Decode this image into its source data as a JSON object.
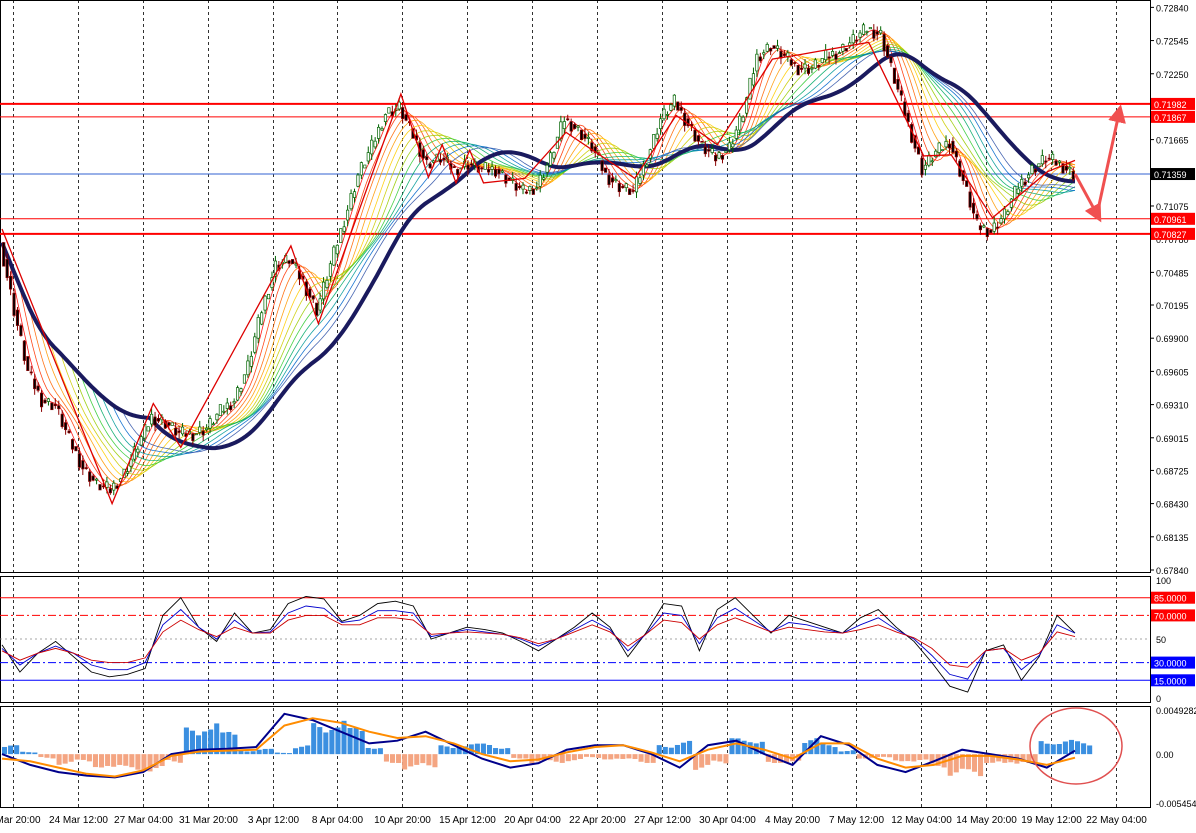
{
  "chart_data": [
    {
      "panel": "main",
      "type": "candlestick",
      "symbol": "",
      "x_tick_labels": [
        "Mar 20:00",
        "24 Mar 12:00",
        "27 Mar 04:00",
        "31 Mar 20:00",
        "3 Apr 12:00",
        "8 Apr 04:00",
        "10 Apr 20:00",
        "15 Apr 12:00",
        "20 Apr 04:00",
        "22 Apr 20:00",
        "27 Apr 12:00",
        "30 Apr 04:00",
        "4 May 20:00",
        "7 May 12:00",
        "12 May 04:00",
        "14 May 20:00",
        "19 May 12:00",
        "22 May 04:00"
      ],
      "y_tick_labels": [
        "0.72840",
        "0.72545",
        "0.72250",
        "0.71665",
        "0.71075",
        "0.70780",
        "0.70485",
        "0.70195",
        "0.69900",
        "0.69605",
        "0.69310",
        "0.69015",
        "0.68725",
        "0.68430",
        "0.68135",
        "0.67840"
      ],
      "ylim": [
        0.6784,
        0.7287
      ],
      "current_price": "0.71359",
      "price_close_path": [
        0.7075,
        0.7015,
        0.696,
        0.6935,
        0.693,
        0.69,
        0.6875,
        0.686,
        0.6855,
        0.687,
        0.6895,
        0.692,
        0.6915,
        0.6905,
        0.6905,
        0.691,
        0.6925,
        0.6935,
        0.6965,
        0.7015,
        0.7055,
        0.706,
        0.704,
        0.7015,
        0.7055,
        0.7095,
        0.7135,
        0.716,
        0.719,
        0.7195,
        0.717,
        0.7145,
        0.715,
        0.714,
        0.7145,
        0.714,
        0.714,
        0.713,
        0.712,
        0.7125,
        0.715,
        0.7185,
        0.7175,
        0.716,
        0.7135,
        0.7125,
        0.712,
        0.715,
        0.7185,
        0.72,
        0.718,
        0.716,
        0.715,
        0.716,
        0.719,
        0.724,
        0.725,
        0.724,
        0.723,
        0.723,
        0.724,
        0.7245,
        0.7255,
        0.7265,
        0.726,
        0.722,
        0.718,
        0.714,
        0.7155,
        0.7165,
        0.713,
        0.709,
        0.7085,
        0.71,
        0.7125,
        0.714,
        0.715,
        0.7145,
        0.7136
      ],
      "horizontal_levels": [
        {
          "label": "0.71982",
          "value": 0.71982,
          "color": "#ff0000"
        },
        {
          "label": "0.71867",
          "value": 0.71867,
          "color": "#ff0000"
        },
        {
          "label": "0.70961",
          "value": 0.70961,
          "color": "#ff0000"
        },
        {
          "label": "0.70827",
          "value": 0.70827,
          "color": "#ff0000"
        }
      ],
      "moving_average_ribbon": true,
      "thick_moving_average_color": "#1a1a5e",
      "zigzag_color": "#dd0000",
      "arrow_color": "#f05050"
    },
    {
      "panel": "oscillator",
      "type": "line",
      "y_tick_labels": [
        "100",
        "50",
        "0"
      ],
      "ylim": [
        0,
        100
      ],
      "levels": [
        {
          "label": "85.0000",
          "value": 85,
          "color": "#ff0000"
        },
        {
          "label": "70.0000",
          "value": 70,
          "color": "#ff0000"
        },
        {
          "label": "30.0000",
          "value": 30,
          "color": "#0000ff"
        },
        {
          "label": "15.0000",
          "value": 15,
          "color": "#0000ff"
        }
      ],
      "series": [
        {
          "color": "#000000",
          "values": [
            45,
            22,
            38,
            48,
            35,
            22,
            18,
            20,
            25,
            70,
            85,
            60,
            48,
            72,
            55,
            58,
            80,
            86,
            84,
            65,
            70,
            80,
            82,
            78,
            50,
            55,
            60,
            58,
            55,
            48,
            40,
            50,
            60,
            72,
            60,
            35,
            55,
            80,
            78,
            40,
            75,
            85,
            70,
            55,
            70,
            65,
            60,
            55,
            68,
            75,
            60,
            48,
            30,
            10,
            5,
            40,
            45,
            15,
            35,
            70,
            55
          ]
        },
        {
          "color": "#0000cc",
          "values": [
            42,
            28,
            38,
            44,
            38,
            28,
            24,
            24,
            30,
            62,
            75,
            60,
            50,
            66,
            55,
            56,
            72,
            78,
            76,
            64,
            66,
            74,
            74,
            72,
            52,
            55,
            58,
            56,
            54,
            50,
            44,
            50,
            58,
            66,
            58,
            40,
            54,
            72,
            70,
            46,
            68,
            76,
            66,
            56,
            64,
            62,
            58,
            55,
            62,
            68,
            58,
            50,
            36,
            20,
            16,
            40,
            42,
            24,
            36,
            62,
            55
          ]
        },
        {
          "color": "#cc0000",
          "values": [
            40,
            32,
            38,
            42,
            38,
            32,
            30,
            30,
            34,
            56,
            66,
            58,
            52,
            60,
            55,
            55,
            66,
            70,
            70,
            62,
            62,
            68,
            68,
            66,
            54,
            55,
            56,
            55,
            54,
            51,
            46,
            50,
            56,
            62,
            56,
            44,
            54,
            66,
            64,
            50,
            62,
            68,
            62,
            56,
            60,
            58,
            56,
            55,
            58,
            62,
            56,
            51,
            42,
            28,
            26,
            40,
            42,
            32,
            38,
            56,
            52
          ]
        }
      ]
    },
    {
      "panel": "histogram",
      "type": "bar",
      "y_tick_labels": [
        "0.0049282",
        "0.00",
        "-0.0054546"
      ],
      "ylim": [
        -0.0054546,
        0.0049282
      ],
      "bar_colors": {
        "positive": "#3b8fe0",
        "negative": "#f4a582"
      },
      "values": [
        0.001,
        0.0003,
        -0.0005,
        -0.0012,
        -0.001,
        -0.0015,
        -0.002,
        -0.0018,
        -0.0022,
        -0.001,
        0.003,
        0.0042,
        0.0025,
        0.0005,
        0.0006,
        0.0002,
        0.001,
        0.0035,
        0.0045,
        0.003,
        0.001,
        -0.001,
        -0.002,
        -0.0015,
        0.001,
        0.0013,
        0.0012,
        0.001,
        -0.0005,
        -0.0012,
        -0.001,
        -0.0008,
        -0.0005,
        -0.0006,
        -0.0008,
        -0.001,
        0.0012,
        0.0015,
        -0.0018,
        -0.0012,
        0.0018,
        0.002,
        -0.001,
        -0.0012,
        0.0018,
        0.0012,
        0.0005,
        -0.0005,
        -0.0005,
        -0.0008,
        -0.001,
        -0.0015,
        -0.0025,
        -0.0028,
        -0.001,
        -0.0015,
        -0.001,
        0.0018,
        0.0016,
        0.0015
      ],
      "series": [
        {
          "color": "#00008b",
          "values": [
            0.0,
            -0.0012,
            -0.002,
            -0.0024,
            -0.0026,
            -0.002,
            0.0,
            0.0005,
            0.0006,
            0.0008,
            0.0045,
            0.0038,
            0.0025,
            0.0012,
            0.0015,
            0.0025,
            0.001,
            -0.0005,
            -0.0015,
            -0.001,
            0.0005,
            0.001,
            0.001,
            0.0,
            -0.0015,
            0.001,
            0.0015,
            0.0,
            -0.0012,
            0.002,
            0.001,
            -0.0012,
            -0.002,
            -0.0008,
            0.0005,
            0.0,
            -0.0005,
            -0.0015,
            0.0004
          ]
        },
        {
          "color": "#ff8c00",
          "values": [
            -0.0005,
            -0.0008,
            -0.0015,
            -0.0022,
            -0.0025,
            -0.0018,
            -0.0002,
            0.0003,
            0.0004,
            0.0005,
            0.0032,
            0.004,
            0.0035,
            0.0025,
            0.0018,
            0.002,
            0.0012,
            0.0,
            -0.0008,
            -0.0006,
            0.0002,
            0.0008,
            0.001,
            0.0002,
            -0.0008,
            0.0005,
            0.0012,
            0.0005,
            -0.0005,
            0.0012,
            0.0012,
            -0.0005,
            -0.0015,
            -0.0012,
            -0.0002,
            -0.0002,
            -0.0006,
            -0.0012,
            -0.0004
          ]
        }
      ]
    }
  ]
}
